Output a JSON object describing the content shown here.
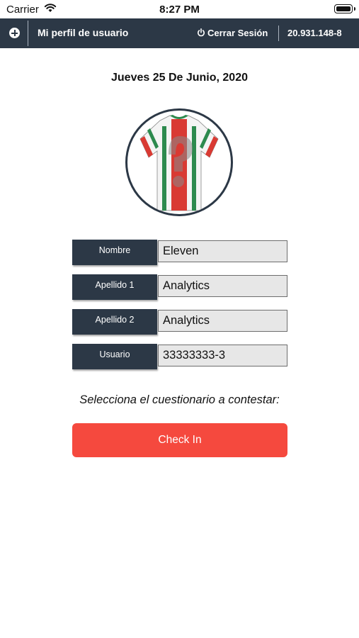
{
  "status_bar": {
    "carrier": "Carrier",
    "time": "8:27 PM"
  },
  "nav": {
    "title": "Mi perfil de usuario",
    "logout_label": "Cerrar Sesión",
    "user_id": "20.931.148-8",
    "accent": "#2c3846"
  },
  "date": "Jueves 25 De Junio, 2020",
  "profile_image_icon": "soccer-jersey-with-question-mark",
  "fields": [
    {
      "label": "Nombre",
      "value": "Eleven"
    },
    {
      "label": "Apellido 1",
      "value": "Analytics"
    },
    {
      "label": "Apellido 2",
      "value": "Analytics"
    },
    {
      "label": "Usuario",
      "value": "33333333-3"
    }
  ],
  "prompt": "Selecciona el cuestionario a contestar:",
  "checkin": {
    "label": "Check In",
    "color": "#f5493e"
  }
}
